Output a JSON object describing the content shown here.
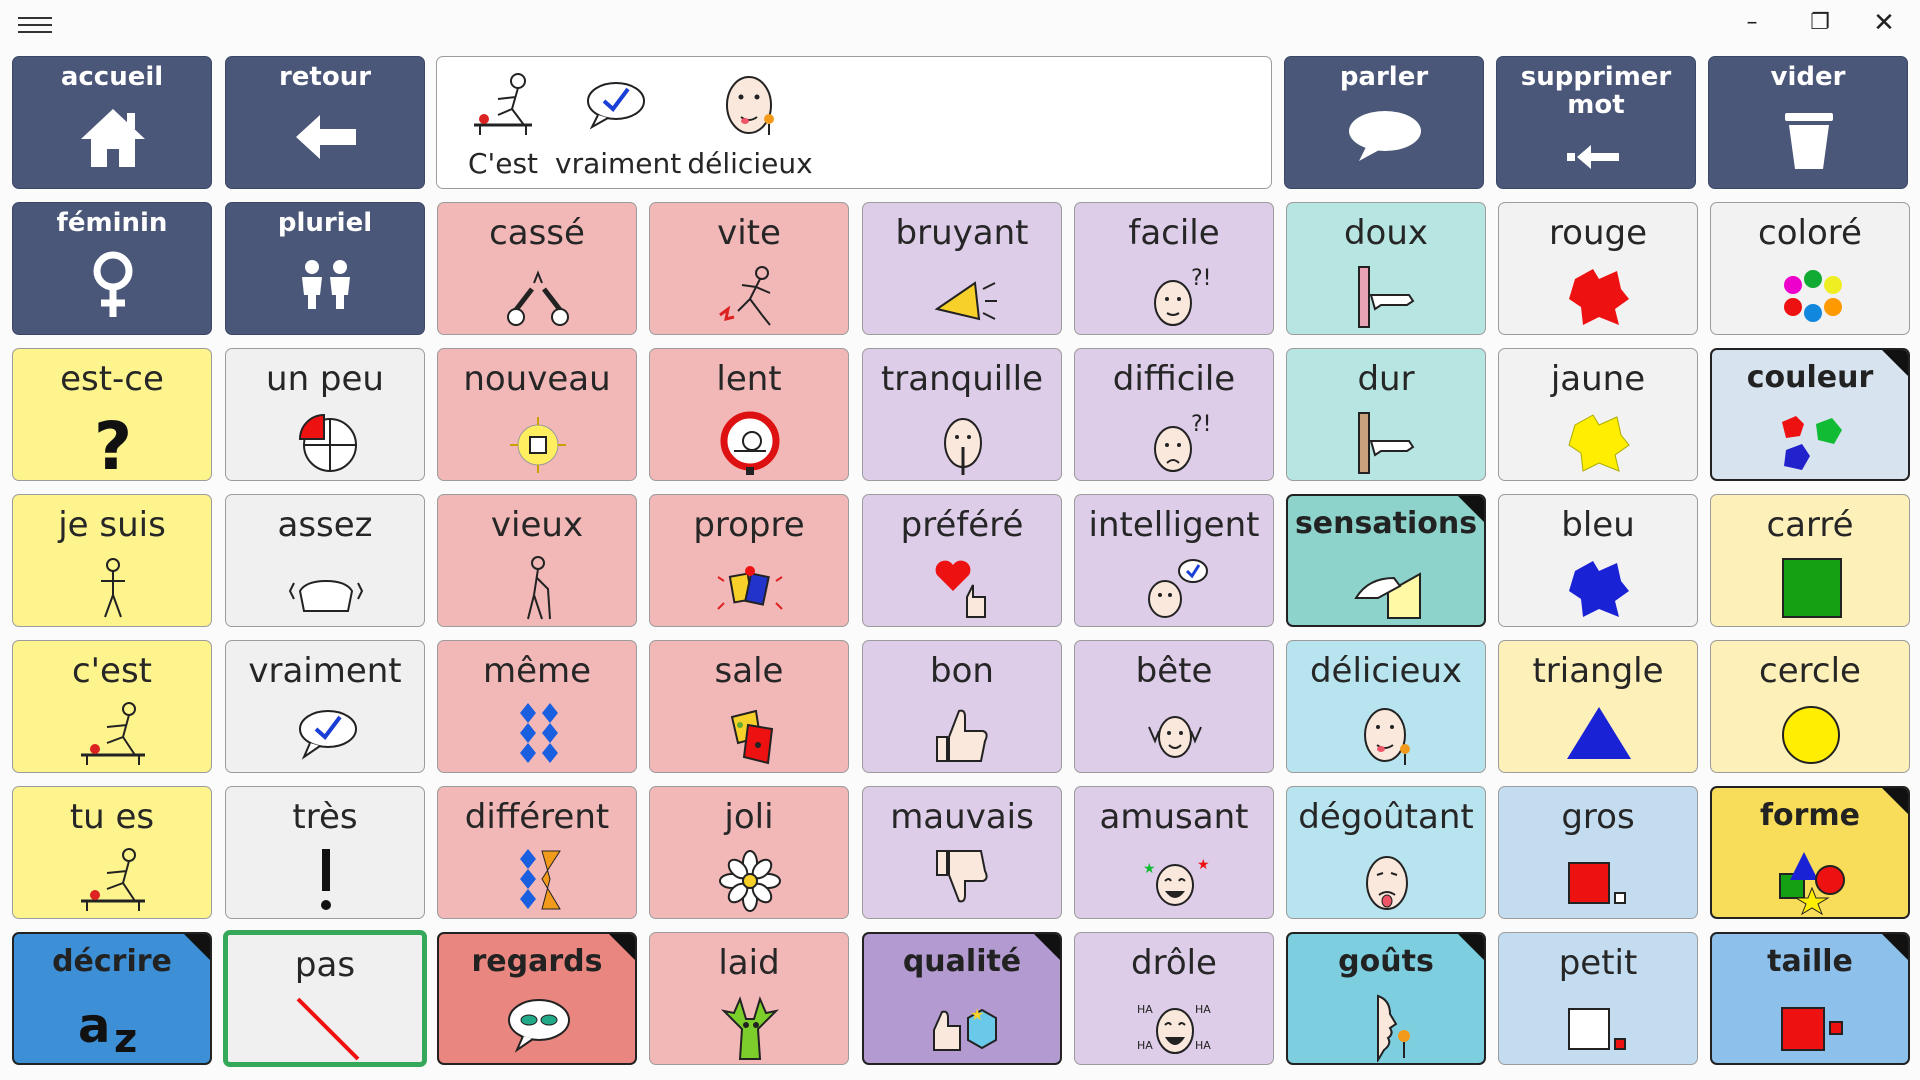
{
  "window": {
    "minimize": "–",
    "maximize": "❐",
    "close": "✕"
  },
  "message_bar": {
    "words": [
      {
        "text": "C'est",
        "icon": "person-at-table-icon"
      },
      {
        "text": "vraiment",
        "icon": "speech-check-icon"
      },
      {
        "text": "délicieux",
        "icon": "face-licking-lips-icon"
      }
    ]
  },
  "nav": {
    "home": "accueil",
    "back": "retour",
    "speak": "parler",
    "delete_word": "supprimer mot",
    "clear": "vider",
    "feminine": "féminin",
    "plural": "pluriel"
  },
  "cells": {
    "casse": "cassé",
    "vite": "vite",
    "bruyant": "bruyant",
    "facile": "facile",
    "doux": "doux",
    "rouge": "rouge",
    "colore": "coloré",
    "est_ce": "est-ce",
    "un_peu": "un peu",
    "nouveau": "nouveau",
    "lent": "lent",
    "tranquille": "tranquille",
    "difficile": "difficile",
    "dur": "dur",
    "jaune": "jaune",
    "couleur": "couleur",
    "je_suis": "je suis",
    "assez": "assez",
    "vieux": "vieux",
    "propre": "propre",
    "prefere": "préféré",
    "intelligent": "intelligent",
    "sensations": "sensations",
    "bleu": "bleu",
    "carre": "carré",
    "c_est": "c'est",
    "vraiment": "vraiment",
    "meme": "même",
    "sale": "sale",
    "bon": "bon",
    "bete": "bête",
    "delicieux": "délicieux",
    "triangle": "triangle",
    "cercle": "cercle",
    "tu_es": "tu es",
    "tres": "très",
    "different": "différent",
    "joli": "joli",
    "mauvais": "mauvais",
    "amusant": "amusant",
    "degoutant": "dégoûtant",
    "gros": "gros",
    "forme": "forme",
    "decrire": "décrire",
    "pas": "pas",
    "regards": "regards",
    "laid": "laid",
    "qualite": "qualité",
    "drole": "drôle",
    "gouts": "goûts",
    "petit": "petit",
    "taille": "taille"
  },
  "colors": {
    "nav": "#4a5779",
    "pronoun": "#fdf48e",
    "adverb": "#f0f0f0",
    "adjective_pink": "#f2b8b8",
    "adjective_lavender": "#ddcde8",
    "sensation_teal": "#b7e5e1",
    "taste_cyan": "#b8e4ef",
    "selection": "#36a85a"
  }
}
